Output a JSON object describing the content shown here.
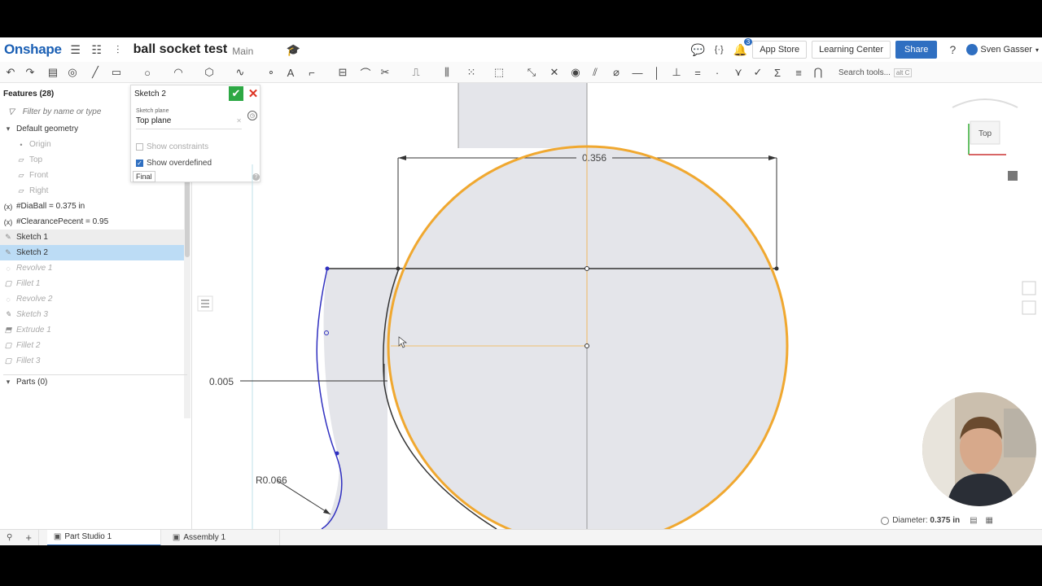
{
  "header": {
    "logo": "Onshape",
    "doc_title": "ball socket test",
    "branch": "Main",
    "notifications": "3",
    "app_store": "App Store",
    "learning_center": "Learning Center",
    "share": "Share",
    "user": "Sven Gasser"
  },
  "toolbar": {
    "search_label": "Search tools...",
    "search_shortcut": "alt C"
  },
  "features": {
    "title": "Features (28)",
    "filter_placeholder": "Filter by name or type",
    "items": [
      {
        "label": "Default geometry"
      },
      {
        "label": "Origin"
      },
      {
        "label": "Top"
      },
      {
        "label": "Front"
      },
      {
        "label": "Right"
      },
      {
        "label": "#DiaBall = 0.375 in"
      },
      {
        "label": "#ClearancePecent = 0.95"
      },
      {
        "label": "Sketch 1"
      },
      {
        "label": "Sketch 2"
      },
      {
        "label": "Revolve 1"
      },
      {
        "label": "Fillet 1"
      },
      {
        "label": "Revolve 2"
      },
      {
        "label": "Sketch 3"
      },
      {
        "label": "Extrude 1"
      },
      {
        "label": "Fillet 2"
      },
      {
        "label": "Fillet 3"
      }
    ],
    "parts": "Parts (0)"
  },
  "sketch_dialog": {
    "title": "Sketch 2",
    "plane_label": "Sketch plane",
    "plane_value": "Top plane",
    "show_constraints": "Show constraints",
    "show_overdefined": "Show overdefined",
    "final": "Final"
  },
  "canvas": {
    "dim_width": "0.356",
    "dim_small": "0.005",
    "dim_radius": "R0.066",
    "view_label": "Top",
    "colors": {
      "circle": "#f0a830",
      "blue": "#3030c0",
      "fill": "#e4e5ea"
    }
  },
  "bottom": {
    "tab1": "Part Studio 1",
    "tab2": "Assembly 1",
    "status_label": "Diameter:",
    "status_value": "0.375 in"
  }
}
